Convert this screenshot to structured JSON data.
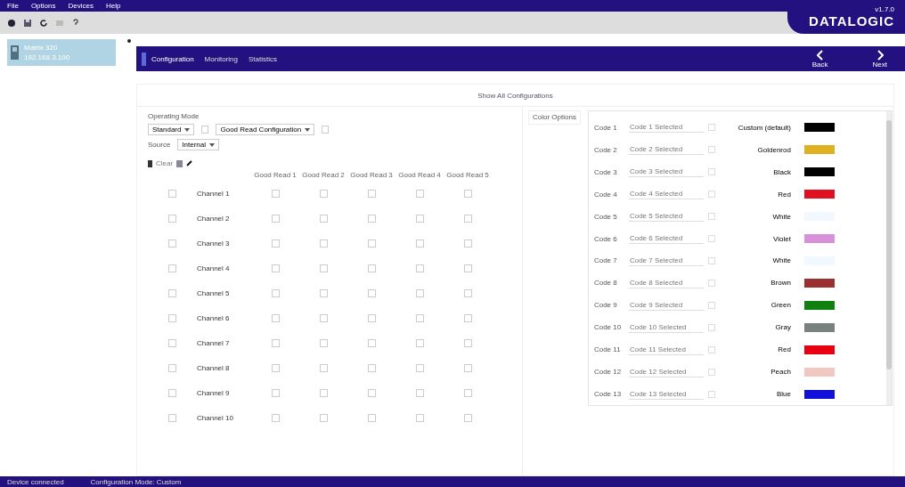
{
  "menu": [
    {
      "label": "File"
    },
    {
      "label": "Options"
    },
    {
      "label": "Devices"
    },
    {
      "label": "Help"
    }
  ],
  "brand": {
    "version": "v1.7.0",
    "logo": "DATALOGIC"
  },
  "device": {
    "name": "Matrix 320",
    "detail": "192.168.3.100"
  },
  "tabs": [
    {
      "label": "Configuration",
      "selected": true
    },
    {
      "label": "Monitoring",
      "selected": false
    },
    {
      "label": "Statistics",
      "selected": false
    }
  ],
  "nav": [
    {
      "label": "Back"
    },
    {
      "label": "Next"
    }
  ],
  "page_title": "Show All Configurations",
  "filters": {
    "label": "Operating Mode",
    "mode": "Standard",
    "option": "Good Read Configuration",
    "source_label": "Source",
    "source": "Internal"
  },
  "table": {
    "toolbar_text": "Clear",
    "columns": [
      "Good Read 1",
      "Good Read 2",
      "Good Read 3",
      "Good Read 4",
      "Good Read 5"
    ],
    "rows": [
      {
        "name": "Channel 1",
        "checked": false,
        "cells": [
          false,
          false,
          false,
          false,
          false
        ]
      },
      {
        "name": "Channel 2",
        "checked": false,
        "cells": [
          false,
          false,
          false,
          false,
          false
        ]
      },
      {
        "name": "Channel 3",
        "checked": false,
        "cells": [
          false,
          false,
          false,
          false,
          false
        ]
      },
      {
        "name": "Channel 4",
        "checked": false,
        "cells": [
          false,
          false,
          false,
          false,
          false
        ]
      },
      {
        "name": "Channel 5",
        "checked": false,
        "cells": [
          false,
          false,
          false,
          false,
          false
        ]
      },
      {
        "name": "Channel 6",
        "checked": false,
        "cells": [
          false,
          false,
          false,
          false,
          false
        ]
      },
      {
        "name": "Channel 7",
        "checked": false,
        "cells": [
          false,
          false,
          false,
          false,
          false
        ]
      },
      {
        "name": "Channel 8",
        "checked": false,
        "cells": [
          false,
          false,
          false,
          false,
          false
        ]
      },
      {
        "name": "Channel 9",
        "checked": false,
        "cells": [
          false,
          false,
          false,
          false,
          false
        ]
      },
      {
        "name": "Channel 10",
        "checked": false,
        "cells": [
          false,
          false,
          false,
          false,
          false
        ]
      }
    ]
  },
  "colors": {
    "label": "Color Options",
    "rows": [
      {
        "code": "Code 1",
        "value": "Code 1 Selected",
        "color_name": "Custom (default)",
        "color": "#000000"
      },
      {
        "code": "Code 2",
        "value": "Code 2 Selected",
        "color_name": "Goldenrod",
        "color": "#e0b020"
      },
      {
        "code": "Code 3",
        "value": "Code 3 Selected",
        "color_name": "Black",
        "color": "#000000"
      },
      {
        "code": "Code 4",
        "value": "Code 4 Selected",
        "color_name": "Red",
        "color": "#e01020"
      },
      {
        "code": "Code 5",
        "value": "Code 5 Selected",
        "color_name": "White",
        "color": "#f2f8ff"
      },
      {
        "code": "Code 6",
        "value": "Code 6 Selected",
        "color_name": "Violet",
        "color": "#d890d8"
      },
      {
        "code": "Code 7",
        "value": "Code 7 Selected",
        "color_name": "White",
        "color": "#f2f8ff"
      },
      {
        "code": "Code 8",
        "value": "Code 8 Selected",
        "color_name": "Brown",
        "color": "#9a3030"
      },
      {
        "code": "Code 9",
        "value": "Code 9 Selected",
        "color_name": "Green",
        "color": "#108010"
      },
      {
        "code": "Code 10",
        "value": "Code 10 Selected",
        "color_name": "Gray",
        "color": "#788080"
      },
      {
        "code": "Code 11",
        "value": "Code 11 Selected",
        "color_name": "Red",
        "color": "#e80010"
      },
      {
        "code": "Code 12",
        "value": "Code 12 Selected",
        "color_name": "Peach",
        "color": "#f0c8c0"
      },
      {
        "code": "Code 13",
        "value": "Code 13 Selected",
        "color_name": "Blue",
        "color": "#1010d8"
      }
    ]
  },
  "status_bar": [
    {
      "text": "Device connected"
    },
    {
      "text": "Configuration Mode: Custom"
    }
  ]
}
